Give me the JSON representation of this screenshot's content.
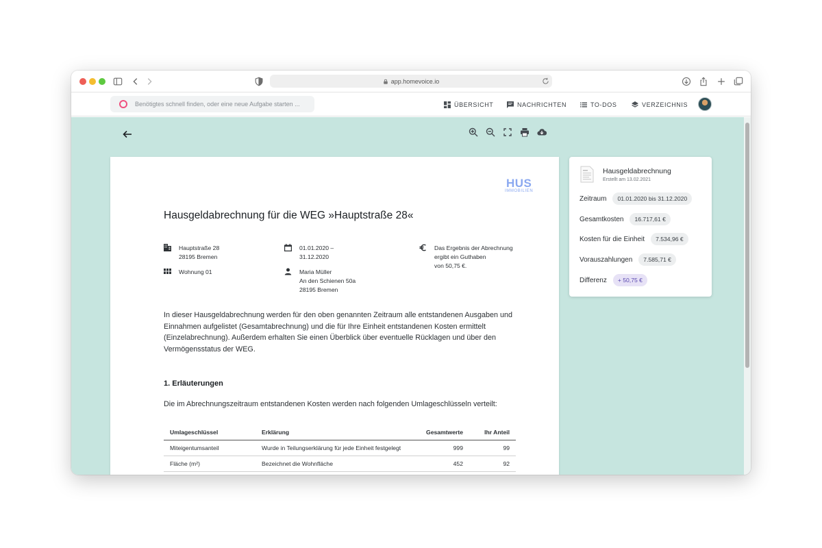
{
  "browser": {
    "url": "app.homevoice.io"
  },
  "appbar": {
    "search_placeholder": "Benötigtes schnell finden, oder eine neue Aufgabe starten ...",
    "nav": [
      {
        "label": "ÜBERSICHT",
        "icon": "dashboard-icon"
      },
      {
        "label": "NACHRICHTEN",
        "icon": "message-icon"
      },
      {
        "label": "TO-DOS",
        "icon": "list-icon"
      },
      {
        "label": "VERZEICHNIS",
        "icon": "layers-icon"
      }
    ]
  },
  "document": {
    "brand_name": "HUS",
    "brand_sub": "IMMOBILIEN",
    "title": "Hausgeldabrechnung für die WEG »Hauptstraße 28«",
    "address_line1": "Hauptstraße 28",
    "address_line2": "28195 Bremen",
    "unit": "Wohnung 01",
    "period_line1": "01.01.2020 –",
    "period_line2": "31.12.2020",
    "owner_line1": "Maria Müller",
    "owner_line2": "An den Schienen 50a",
    "owner_line3": "28195 Bremen",
    "result_line1": "Das Ergebnis der Abrechnung",
    "result_line2": "ergibt ein Guthaben",
    "result_line3": "von 50,75 €.",
    "intro": "In dieser Hausgeldabrechnung werden für den oben genannten Zeitraum alle entstandenen Ausgaben und Einnahmen aufgelistet (Gesamtabrechnung) und die für Ihre Einheit entstandenen Kosten ermittelt (Einzelabrechnung). Außerdem erhalten Sie einen Überblick über eventuelle Rücklagen und über den Vermögensstatus der WEG.",
    "section_heading": "1. Erläuterungen",
    "section_text": "Die im Abrechnungszeitraum entstandenen Kosten werden nach folgenden Umlageschlüsseln verteilt:",
    "table": {
      "headers": [
        "Umlageschlüssel",
        "Erklärung",
        "Gesamtwerte",
        "Ihr Anteil"
      ],
      "rows": [
        [
          "Miteigentumsanteil",
          "Wurde in Teilungserklärung für jede Einheit festgelegt",
          "999",
          "99"
        ],
        [
          "Fläche (m²)",
          "Bezeichnet die Wohnfläche",
          "452",
          "92"
        ]
      ]
    }
  },
  "summary_card": {
    "title": "Hausgeldabrechnung",
    "subtitle": "Erstellt am 13.02.2021",
    "rows": [
      {
        "label": "Zeitraum",
        "value": "01.01.2020 bis 31.12.2020"
      },
      {
        "label": "Gesamtkosten",
        "value": "16.717,61 €"
      },
      {
        "label": "Kosten für die Einheit",
        "value": "7.534,96 €"
      },
      {
        "label": "Vorauszahlungen",
        "value": "7.585,71 €"
      },
      {
        "label": "Differenz",
        "value": "+ 50,75 €"
      }
    ]
  }
}
